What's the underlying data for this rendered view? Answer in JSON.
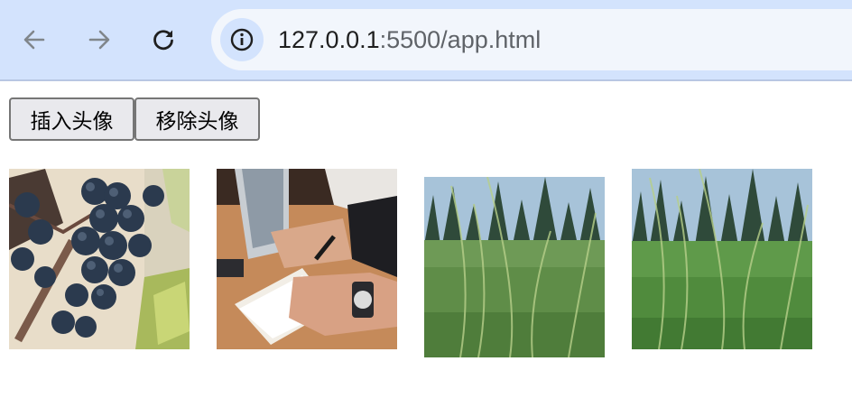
{
  "browser": {
    "url_host": "127.0.0.1",
    "url_rest": ":5500/app.html",
    "back_icon": "arrow-left-icon",
    "forward_icon": "arrow-right-icon",
    "reload_icon": "reload-icon",
    "site_info_icon": "info-icon"
  },
  "page": {
    "insert_button_label": "插入头像",
    "remove_button_label": "移除头像",
    "avatars": [
      {
        "subject": "grapes"
      },
      {
        "subject": "writing-notebook"
      },
      {
        "subject": "grass-field"
      },
      {
        "subject": "grass-field"
      }
    ]
  }
}
